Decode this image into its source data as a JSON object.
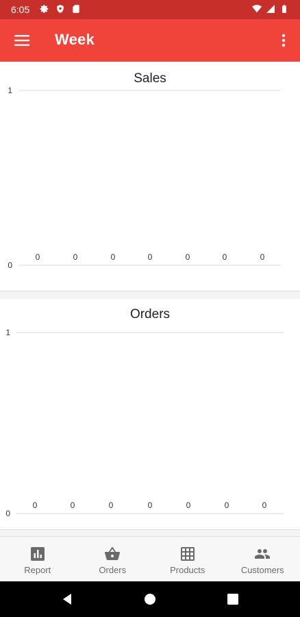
{
  "status_bar": {
    "time": "6:05"
  },
  "app_bar": {
    "title": "Week",
    "bg_color": "#f0433a"
  },
  "theme": {
    "accent": "#ea3b33",
    "status_bar_color": "#c62f2a"
  },
  "charts": [
    {
      "id": "sales",
      "title": "Sales",
      "y_max_label": "1",
      "y_min_label": "0",
      "data_labels": [
        "0",
        "0",
        "0",
        "0",
        "0",
        "0",
        "0"
      ]
    },
    {
      "id": "orders",
      "title": "Orders",
      "y_max_label": "1",
      "y_min_label": "0",
      "data_labels": [
        "0",
        "0",
        "0",
        "0",
        "0",
        "0",
        "0"
      ]
    }
  ],
  "chart_data": [
    {
      "type": "bar",
      "title": "Sales",
      "values": [
        0,
        0,
        0,
        0,
        0,
        0,
        0
      ],
      "ylim": [
        0,
        1
      ],
      "y_ticks": [
        "0",
        "1"
      ],
      "grid": true
    },
    {
      "type": "bar",
      "title": "Orders",
      "values": [
        0,
        0,
        0,
        0,
        0,
        0,
        0
      ],
      "ylim": [
        0,
        1
      ],
      "y_ticks": [
        "0",
        "1"
      ],
      "grid": true
    }
  ],
  "bottom_nav": {
    "items": [
      {
        "label": "Report",
        "icon": "bar-chart-icon",
        "active": true
      },
      {
        "label": "Orders",
        "icon": "basket-icon",
        "active": false
      },
      {
        "label": "Products",
        "icon": "grid-icon",
        "active": false
      },
      {
        "label": "Customers",
        "icon": "people-icon",
        "active": false
      }
    ]
  }
}
